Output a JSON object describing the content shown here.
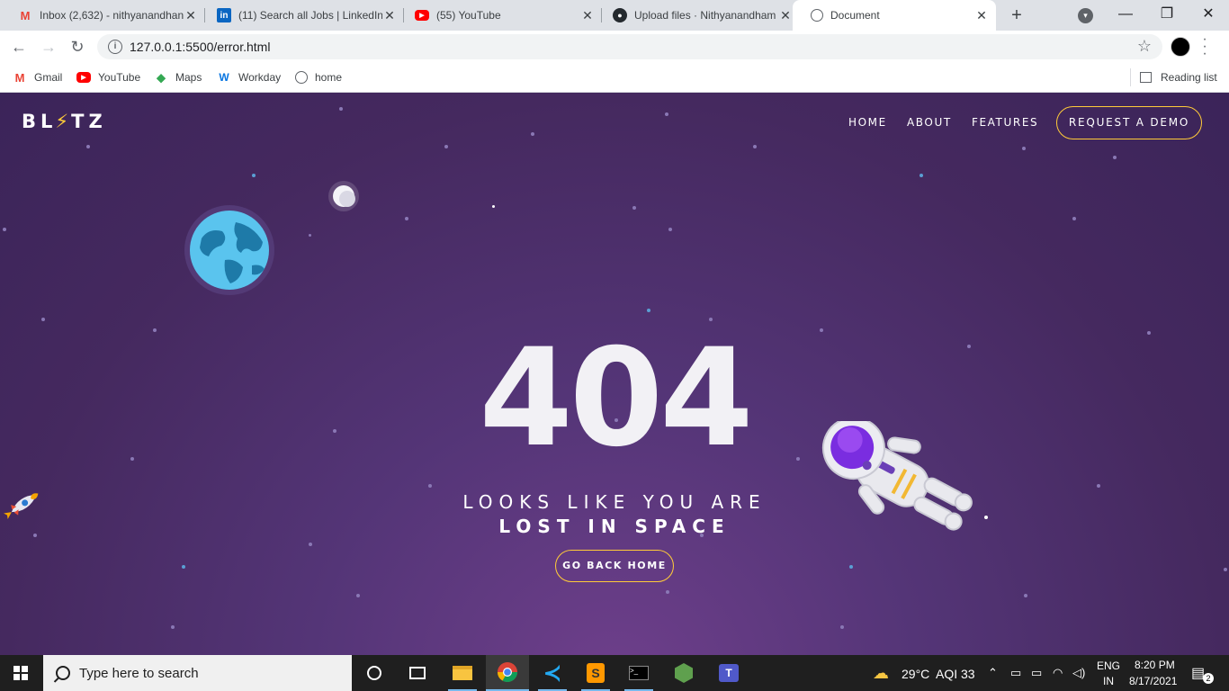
{
  "browser": {
    "tabs": [
      {
        "title": "Inbox (2,632) - nithyanandhan",
        "icon": "gmail-icon"
      },
      {
        "title": "(11) Search all Jobs | LinkedIn",
        "icon": "linkedin-icon"
      },
      {
        "title": "(55) YouTube",
        "icon": "youtube-icon"
      },
      {
        "title": "Upload files · Nithyanandham",
        "icon": "github-icon"
      },
      {
        "title": "Document",
        "icon": "globe-icon"
      }
    ],
    "new_tab": "+",
    "url": "127.0.0.1:5500/error.html",
    "bookmarks": [
      "Gmail",
      "YouTube",
      "Maps",
      "Workday",
      "home"
    ],
    "reading_list": "Reading list"
  },
  "site": {
    "logo_left": "BL",
    "logo_bolt": "⚡",
    "logo_right": "TZ",
    "nav": [
      "HOME",
      "ABOUT",
      "FEATURES"
    ],
    "cta": "REQUEST A DEMO",
    "code": "404",
    "line1": "LOOKS LIKE YOU ARE",
    "line2": "LOST IN SPACE",
    "home_button": "GO BACK HOME"
  },
  "taskbar": {
    "search_placeholder": "Type here to search",
    "weather": "29°C",
    "aqi": "AQI 33",
    "lang_top": "ENG",
    "lang_bottom": "IN",
    "time": "8:20 PM",
    "date": "8/17/2021",
    "notifications": "2"
  },
  "colors": {
    "accent": "#ffcb39",
    "page_bg": "#45295f",
    "taskbar": "#1f1f1f"
  }
}
